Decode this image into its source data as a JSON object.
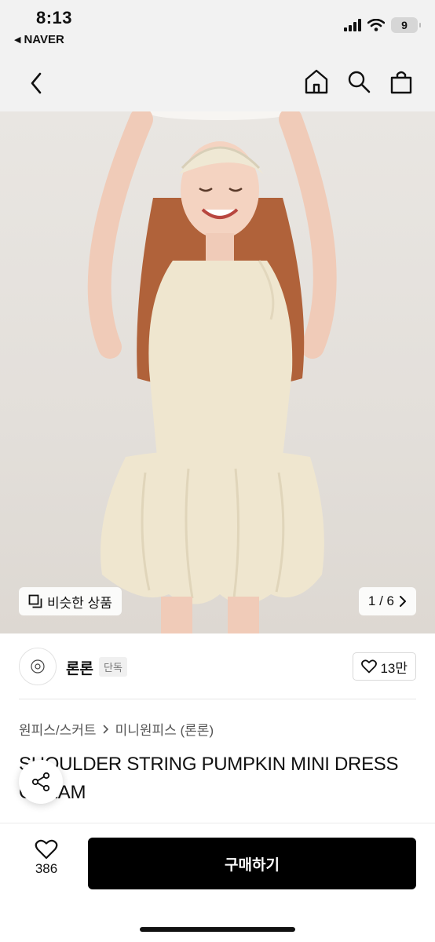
{
  "status_bar": {
    "time": "8:13",
    "back_app": "NAVER",
    "battery": "9"
  },
  "nav": {
    "icons": [
      "back-icon",
      "home-icon",
      "search-icon",
      "bag-icon"
    ]
  },
  "gallery": {
    "similar_label": "비슷한 상품",
    "page_indicator": "1 / 6"
  },
  "shop": {
    "name": "론론",
    "badge": "단독",
    "likes": "13만"
  },
  "product": {
    "category_main": "원피스/스커트",
    "category_sub": "미니원피스 (론론)",
    "title": "SHOULDER STRING PUMPKIN MINI DRESS CREAM"
  },
  "bottom_bar": {
    "wish_count": "386",
    "buy_label": "구매하기"
  },
  "colors": {
    "buy_button": "#000000",
    "nav_background": "#f2f2f2",
    "dress": "#efe6cf"
  }
}
